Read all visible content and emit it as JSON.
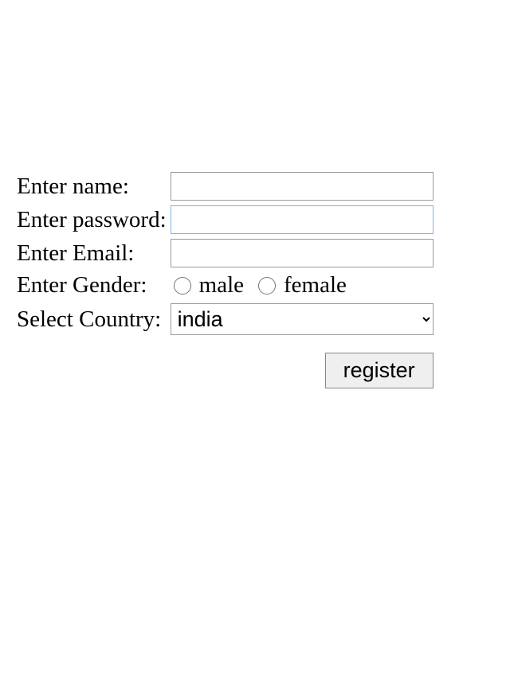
{
  "form": {
    "name": {
      "label": "Enter name:",
      "value": ""
    },
    "password": {
      "label": "Enter password:",
      "value": ""
    },
    "email": {
      "label": "Enter Email:",
      "value": ""
    },
    "gender": {
      "label": "Enter Gender:",
      "options": {
        "male": "male",
        "female": "female"
      }
    },
    "country": {
      "label": "Select Country:",
      "selected": "india"
    },
    "submit": {
      "label": "register"
    }
  }
}
